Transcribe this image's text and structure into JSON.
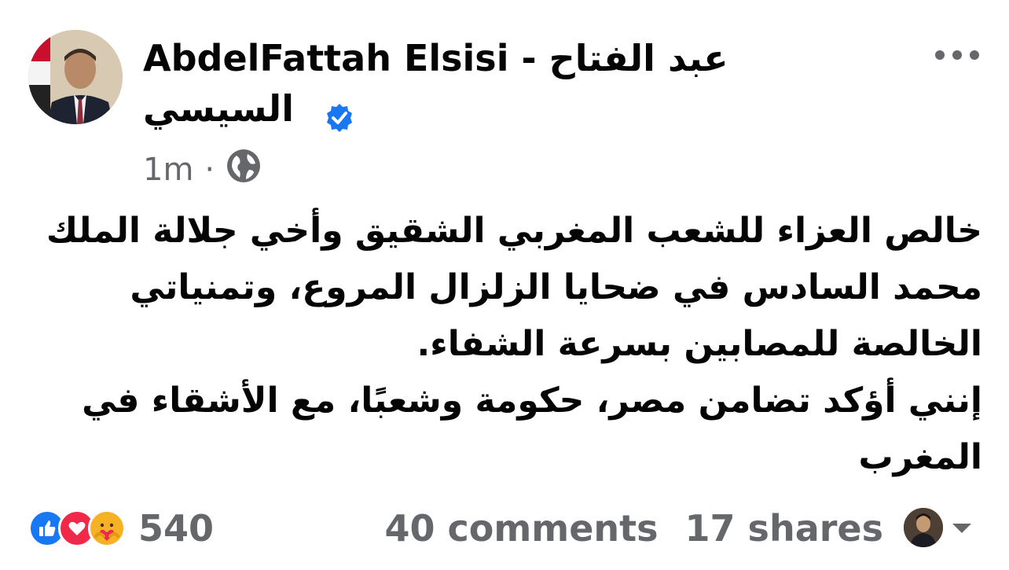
{
  "post": {
    "author_latin": "AbdelFattah Elsisi -",
    "author_arabic": "عبد الفتاح السيسي",
    "timestamp": "1m",
    "separator": "·",
    "privacy_icon": "globe-icon",
    "verified_icon": "verified-badge-icon",
    "more_icon": "more-horizontal-icon",
    "text": "خالص العزاء للشعب المغربي الشقيق وأخي جلالة الملك محمد السادس في ضحايا الزلزال المروع، وتمنياتي الخالصة للمصابين بسرعة الشفاء.\nإنني أؤكد تضامن مصر، حكومة وشعبًا، مع الأشقاء في المغرب"
  },
  "footer": {
    "reaction_icons": [
      "like-icon",
      "love-icon",
      "care-icon"
    ],
    "reaction_count": "540",
    "comments": "40 comments",
    "shares": "17 shares",
    "viewer_avatar_icon": "viewer-avatar",
    "dropdown_icon": "caret-down-icon"
  },
  "colors": {
    "verified": "#1877f2",
    "like": "#1877f2",
    "love": "#f02849",
    "care": "#f7b125",
    "secondary_text": "#65676b",
    "primary_text": "#050505"
  }
}
